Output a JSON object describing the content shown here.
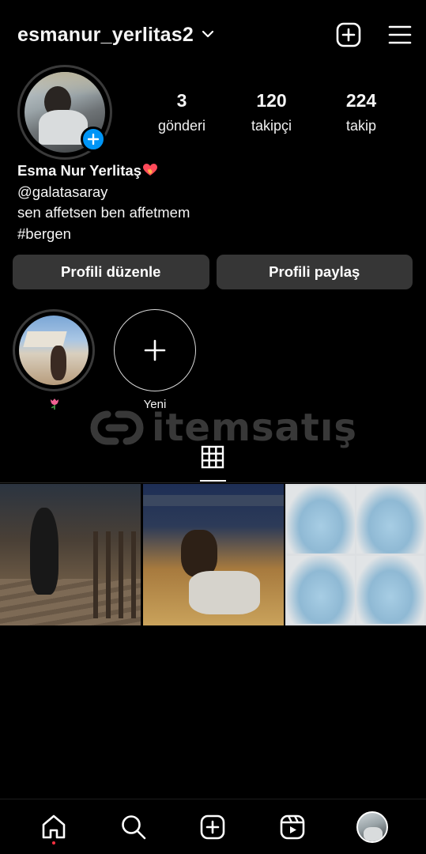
{
  "header": {
    "username": "esmanur_yerlitas2",
    "icons": [
      "chevron-down-icon",
      "new-post-icon",
      "menu-icon"
    ]
  },
  "profile": {
    "posts_count": "3",
    "posts_label": "gönderi",
    "followers_count": "120",
    "followers_label": "takipçi",
    "following_count": "224",
    "following_label": "takip"
  },
  "bio": {
    "name": "Esma Nur Yerlitaş",
    "mention": "@galatasaray",
    "line": "sen affetsen ben affetmem",
    "hashtag": "#bergen"
  },
  "buttons": {
    "edit_profile": "Profili düzenle",
    "share_profile": "Profili paylaş"
  },
  "highlights": [
    {
      "label": "",
      "emoji": "tulip"
    },
    {
      "label": "Yeni"
    }
  ],
  "watermark": {
    "text": "itemsatış"
  },
  "tabs": {
    "active": "grid-icon"
  },
  "bottom_nav": [
    "home-icon",
    "search-icon",
    "create-icon",
    "reels-icon",
    "profile-avatar"
  ],
  "colors": {
    "background": "#000000",
    "button_bg": "#363636",
    "accent_blue": "#0095f6",
    "notification_red": "#ff3040"
  }
}
